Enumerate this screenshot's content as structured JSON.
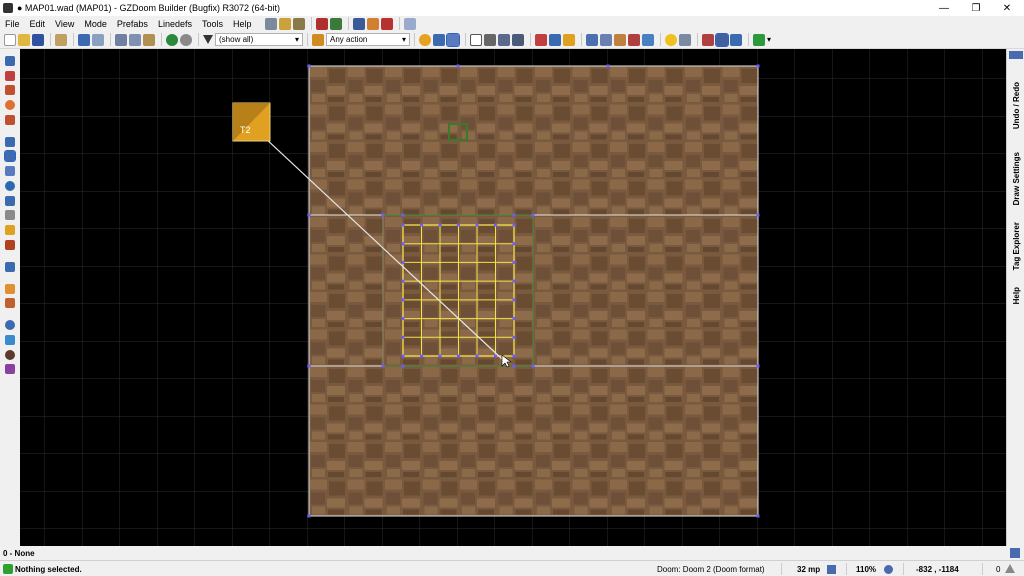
{
  "window": {
    "title": "● MAP01.wad (MAP01) - GZDoom Builder (Bugfix) R3072 (64-bit)",
    "minimize": "—",
    "maximize": "❐",
    "close": "✕"
  },
  "menu": [
    "File",
    "Edit",
    "View",
    "Mode",
    "Prefabs",
    "Linedefs",
    "Tools",
    "Help"
  ],
  "toolbar": {
    "filter_value": "(show all)",
    "action_value": "Any action"
  },
  "dock_tabs": [
    "Undo / Redo",
    "Draw Settings",
    "Tag Explorer",
    "Help"
  ],
  "map": {
    "thing_label": "T2"
  },
  "infobar": {
    "text": "0 - None"
  },
  "status": {
    "message": "Nothing selected.",
    "game_config": "Doom: Doom 2 (Doom format)",
    "grid_size": "32 mp",
    "zoom": "110%",
    "coordinates": "-832 , -1184",
    "selection_count": "0"
  },
  "colors": {
    "floor": "#7a5a3e",
    "grid": "#2b2b2b",
    "sector_border": "#e6e6e6",
    "highlight": "#f2e24a",
    "vertex": "#6b5cff",
    "thing": "#e0a020"
  }
}
